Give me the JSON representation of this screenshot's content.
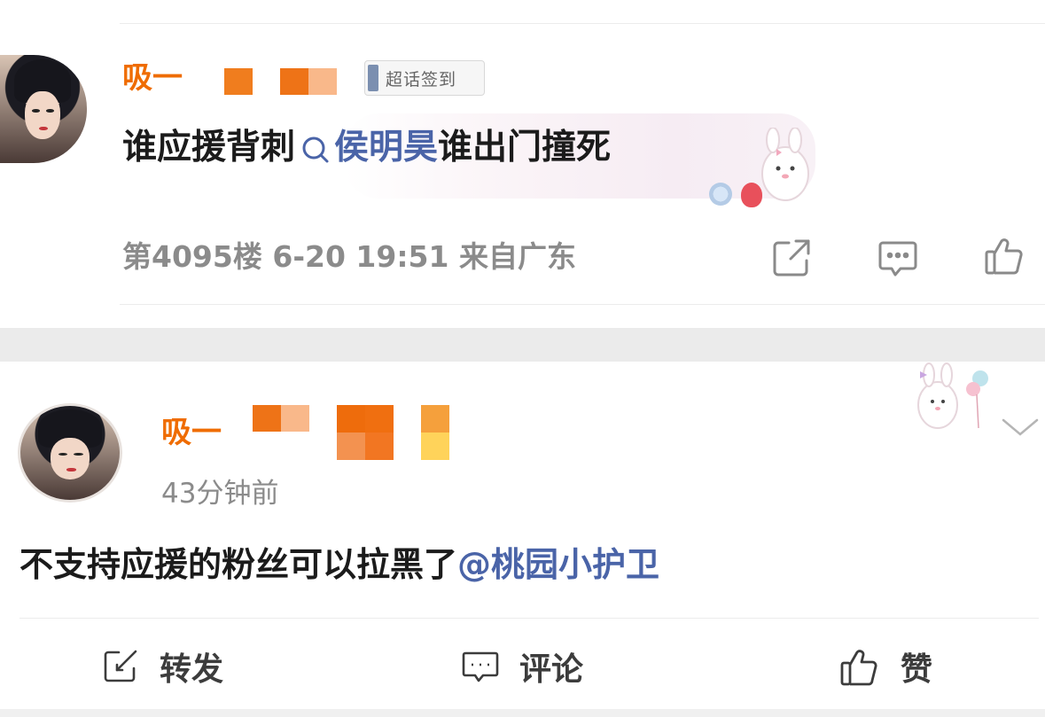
{
  "comment": {
    "username": "吸一",
    "badge_label": "超话签到",
    "text_before": "谁应援背刺",
    "topic": "侯明昊",
    "text_after": " 谁出门撞死",
    "floor": "第4095楼",
    "date": "6-20 19:51",
    "location": "来自广东",
    "icons": [
      "share-icon",
      "comment-icon",
      "like-icon"
    ]
  },
  "post": {
    "username": "吸一",
    "time": "43分钟前",
    "text": "不支持应援的粉丝可以拉黑了",
    "mention": "@桃园小护卫",
    "actions": {
      "repost": "转发",
      "comment": "评论",
      "like": "赞"
    }
  },
  "colors": {
    "username": "#ef6c00",
    "link": "#4a64a8",
    "meta": "#8b8b8b",
    "separator": "#ebebeb"
  }
}
